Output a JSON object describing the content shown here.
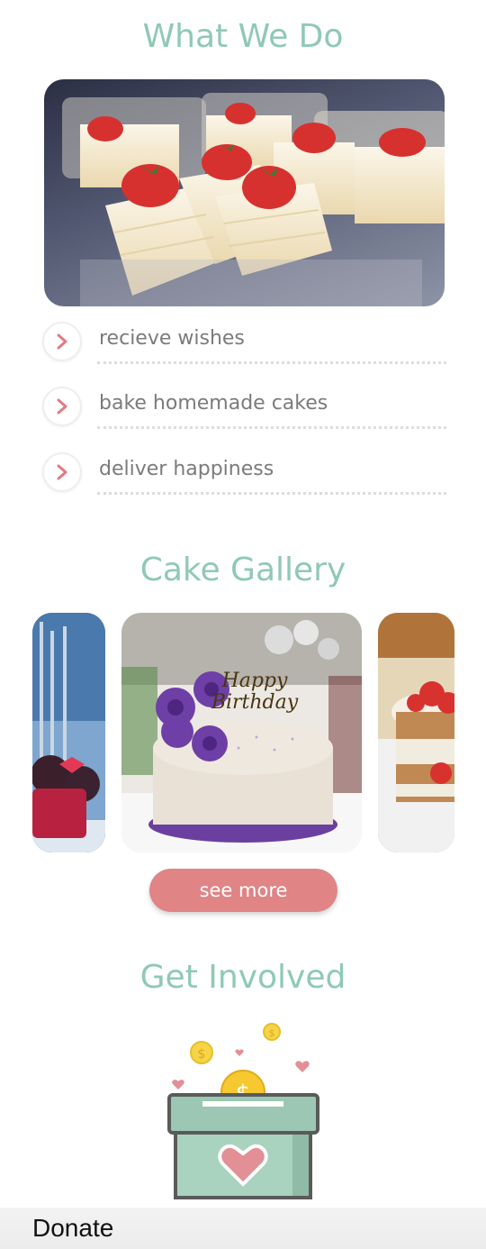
{
  "what_we_do": {
    "title": "What We Do",
    "items": [
      {
        "label": "recieve wishes"
      },
      {
        "label": "bake homemade cakes"
      },
      {
        "label": "deliver happiness"
      }
    ]
  },
  "gallery": {
    "title": "Cake Gallery",
    "cake_topper_line1": "Happy",
    "cake_topper_line2": "Birthday",
    "see_more_label": "see more"
  },
  "get_involved": {
    "title": "Get Involved",
    "coin_symbol": "$"
  },
  "bottom_nav": {
    "donate_label": "Donate"
  },
  "colors": {
    "accent_mint": "#8fc9b5",
    "button_pink": "#e08486",
    "chevron_pink": "#e07b80",
    "text_gray": "#7b7b7b"
  }
}
